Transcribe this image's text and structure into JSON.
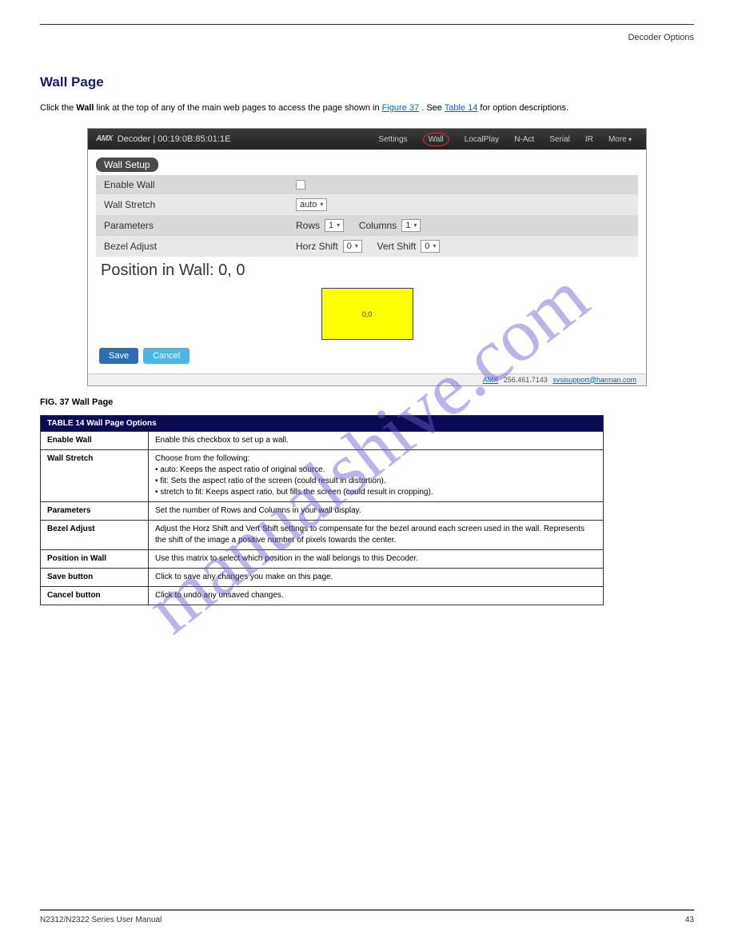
{
  "header_right": "Decoder Options",
  "section_title": "Wall Page",
  "intro_parts": {
    "p1": "Click the ",
    "wall_link": "Wall",
    "p2": " link at the top of any of the main web pages to access the page shown in ",
    "fig_link": "Figure 37",
    "p3": ". See ",
    "table_link": "Table 14",
    "p4": " for option descriptions."
  },
  "screenshot": {
    "logo": "AMX",
    "device_title": "Decoder | 00:19:0B:85:01:1E",
    "nav": [
      "Settings",
      "Wall",
      "LocalPlay",
      "N-Act",
      "Serial",
      "IR",
      "More"
    ],
    "badge": "Wall Setup",
    "rows": {
      "enable_wall": "Enable Wall",
      "wall_stretch": "Wall Stretch",
      "wall_stretch_val": "auto",
      "parameters": "Parameters",
      "params_rows_lbl": "Rows",
      "params_rows_val": "1",
      "params_cols_lbl": "Columns",
      "params_cols_val": "1",
      "bezel": "Bezel Adjust",
      "bezel_horz_lbl": "Horz Shift",
      "bezel_horz_val": "0",
      "bezel_vert_lbl": "Vert Shift",
      "bezel_vert_val": "0"
    },
    "position_text": "Position in Wall: 0, 0",
    "yellow_label": "0,0",
    "save_btn": "Save",
    "cancel_btn": "Cancel",
    "footer_amx": "AMX",
    "footer_phone": "256.461.7143",
    "footer_email": "svsisupport@harman.com"
  },
  "fig_caption": "FIG. 37 Wall Page",
  "table_header": "TABLE 14  Wall Page Options",
  "table": [
    {
      "opt": "Enable Wall",
      "desc": "Enable this checkbox to set up a wall."
    },
    {
      "opt": "Wall Stretch",
      "desc": "Choose from the following:\n• auto: Keeps the aspect ratio of original source.\n• fit: Sets the aspect ratio of the screen (could result in distortion).\n• stretch to fit: Keeps aspect ratio, but fills the screen (could result in cropping)."
    },
    {
      "opt": "Parameters",
      "desc": "Set the number of Rows and Columns in your wall display."
    },
    {
      "opt": "Bezel Adjust",
      "desc": "Adjust the Horz Shift and Vert Shift settings to compensate for the bezel around each screen used in the wall. Represents the shift of the image a positive number of pixels towards the center."
    },
    {
      "opt": "Position in Wall",
      "desc": "Use this matrix to select which position in the wall belongs to this Decoder."
    },
    {
      "opt": "Save button",
      "desc": "Click to save any changes you make on this page."
    },
    {
      "opt": "Cancel button",
      "desc": "Click to undo any unsaved changes."
    }
  ],
  "watermark": "manualshive.com",
  "footer_left": "N2312/N2322 Series User Manual",
  "footer_right": "43"
}
